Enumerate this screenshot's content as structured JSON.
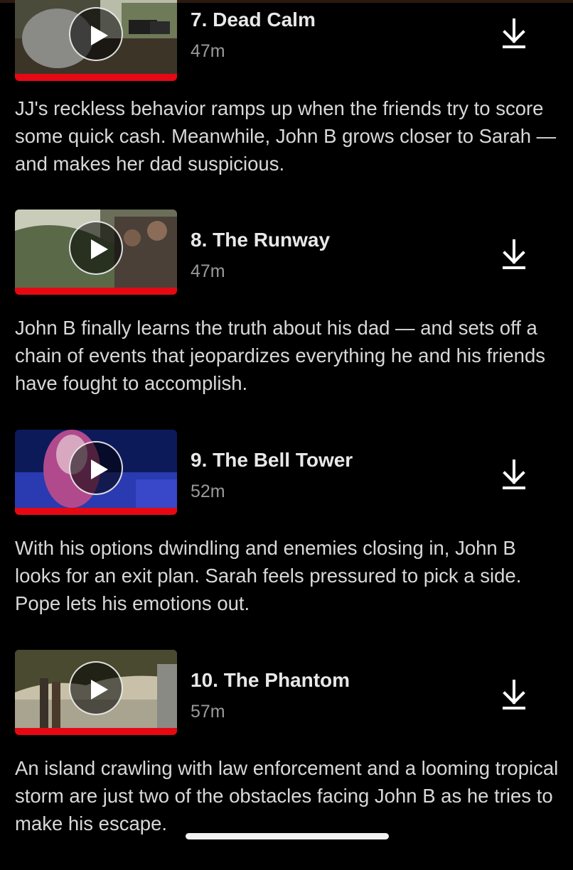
{
  "episodes": [
    {
      "title": "7. Dead Calm",
      "duration": "47m",
      "synopsis": "JJ's reckless behavior ramps up when the friends try to score some quick cash. Meanwhile, John B grows closer to Sarah — and makes her dad suspicious.",
      "progress": 1.0,
      "play_icon": "play-icon",
      "download_icon": "download-icon"
    },
    {
      "title": "8. The Runway",
      "duration": "47m",
      "synopsis": "John B finally learns the truth about his dad — and sets off a chain of events that jeopardizes everything he and his friends have fought to accomplish.",
      "progress": 1.0,
      "play_icon": "play-icon",
      "download_icon": "download-icon"
    },
    {
      "title": "9. The Bell Tower",
      "duration": "52m",
      "synopsis": "With his options dwindling and enemies closing in, John B looks for an exit plan. Sarah feels pressured to pick a side. Pope lets his emotions out.",
      "progress": 1.0,
      "play_icon": "play-icon",
      "download_icon": "download-icon"
    },
    {
      "title": "10. The Phantom",
      "duration": "57m",
      "synopsis": "An island crawling with law enforcement and a looming tropical storm are just two of the obstacles facing John B as he tries to make his escape.",
      "progress": 1.0,
      "play_icon": "play-icon",
      "download_icon": "download-icon"
    }
  ],
  "colors": {
    "background": "#000000",
    "progress": "#e50914",
    "title": "#e8e8e8",
    "duration": "#9a9a9a",
    "synopsis": "#d8d8d8"
  }
}
